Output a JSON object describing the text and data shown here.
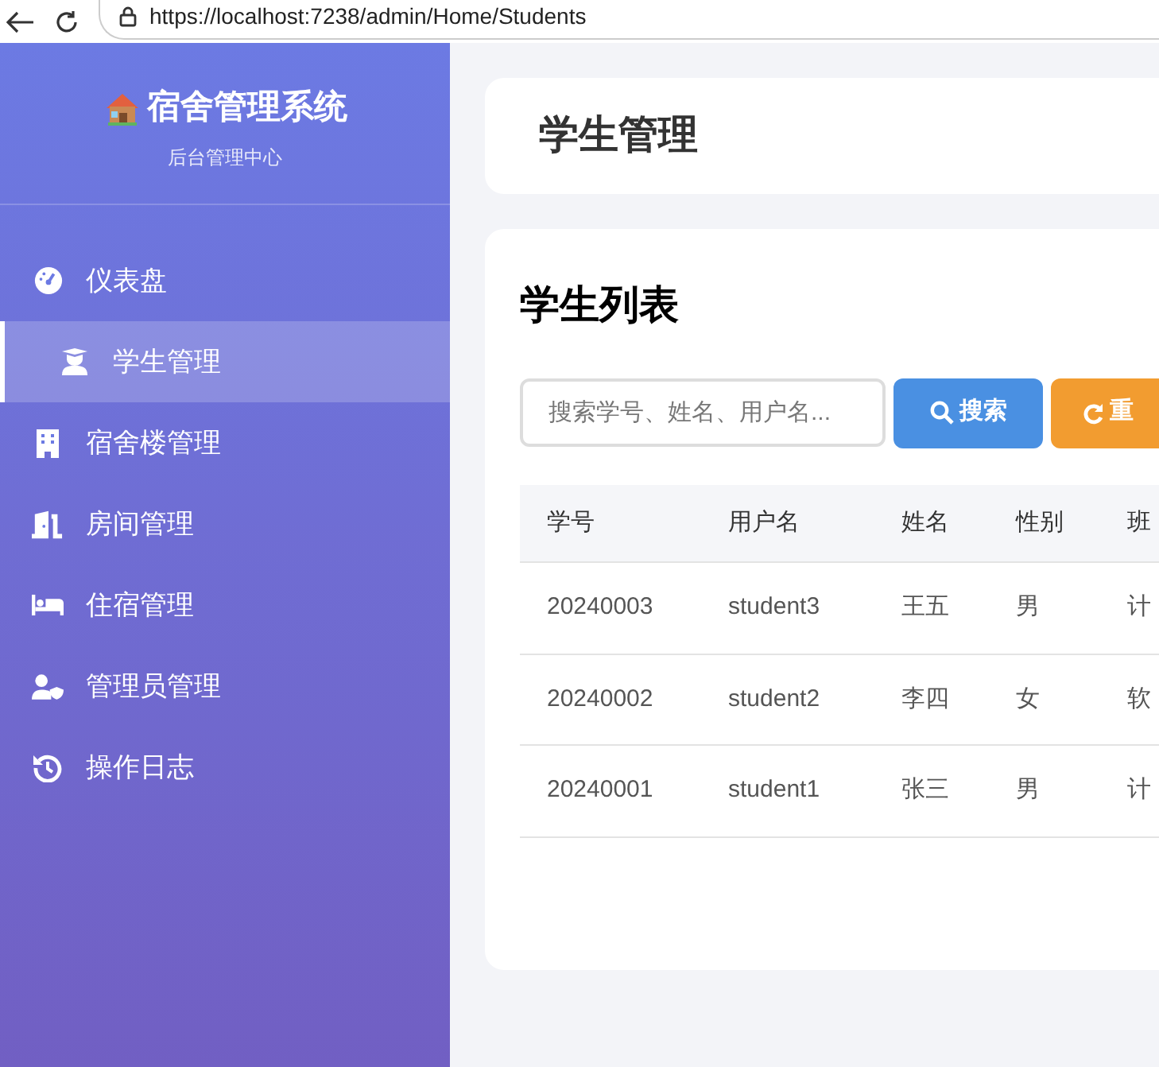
{
  "browser": {
    "url": "https://localhost:7238/admin/Home/Students"
  },
  "sidebar": {
    "title": "宿舍管理系统",
    "subtitle": "后台管理中心",
    "items": [
      {
        "label": "仪表盘",
        "selected": false
      },
      {
        "label": "学生管理",
        "selected": true
      },
      {
        "label": "宿舍楼管理",
        "selected": false
      },
      {
        "label": "房间管理",
        "selected": false
      },
      {
        "label": "住宿管理",
        "selected": false
      },
      {
        "label": "管理员管理",
        "selected": false
      },
      {
        "label": "操作日志",
        "selected": false
      }
    ]
  },
  "page_title": "学生管理",
  "list": {
    "title": "学生列表",
    "search": {
      "placeholder": "搜索学号、姓名、用户名..."
    },
    "buttons": [
      {
        "label": "搜索",
        "kind": "search"
      },
      {
        "label": "重",
        "kind": "reset"
      }
    ],
    "table": {
      "columns": [
        "学号",
        "用户名",
        "姓名",
        "性别",
        "班"
      ],
      "rows": [
        [
          "20240003",
          "student3",
          "王五",
          "男",
          "计"
        ],
        [
          "20240002",
          "student2",
          "李四",
          "女",
          "软"
        ],
        [
          "20240001",
          "student1",
          "张三",
          "男",
          "计"
        ]
      ]
    }
  }
}
